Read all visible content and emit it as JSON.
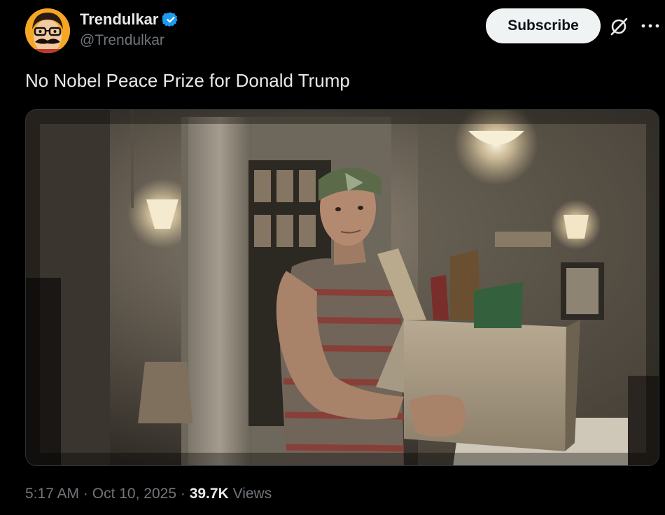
{
  "author": {
    "display_name": "Trendulkar",
    "handle": "@Trendulkar",
    "verified": true,
    "avatar_icon": "cartoon-face-avatar"
  },
  "actions": {
    "subscribe_label": "Subscribe",
    "grok_icon": "grok-icon",
    "more_icon": "more-horizontal-icon"
  },
  "tweet": {
    "text": "No Nobel Peace Prize for Donald Trump",
    "media_description_icon": "video-still"
  },
  "meta": {
    "time": "5:17 AM",
    "separator": "·",
    "date": "Oct 10, 2025",
    "views_count": "39.7K",
    "views_label": "Views"
  },
  "colors": {
    "background": "#000000",
    "text_primary": "#e7e9ea",
    "text_secondary": "#71767b",
    "verified_blue": "#1d9bf0",
    "subscribe_bg": "#eff3f4"
  }
}
